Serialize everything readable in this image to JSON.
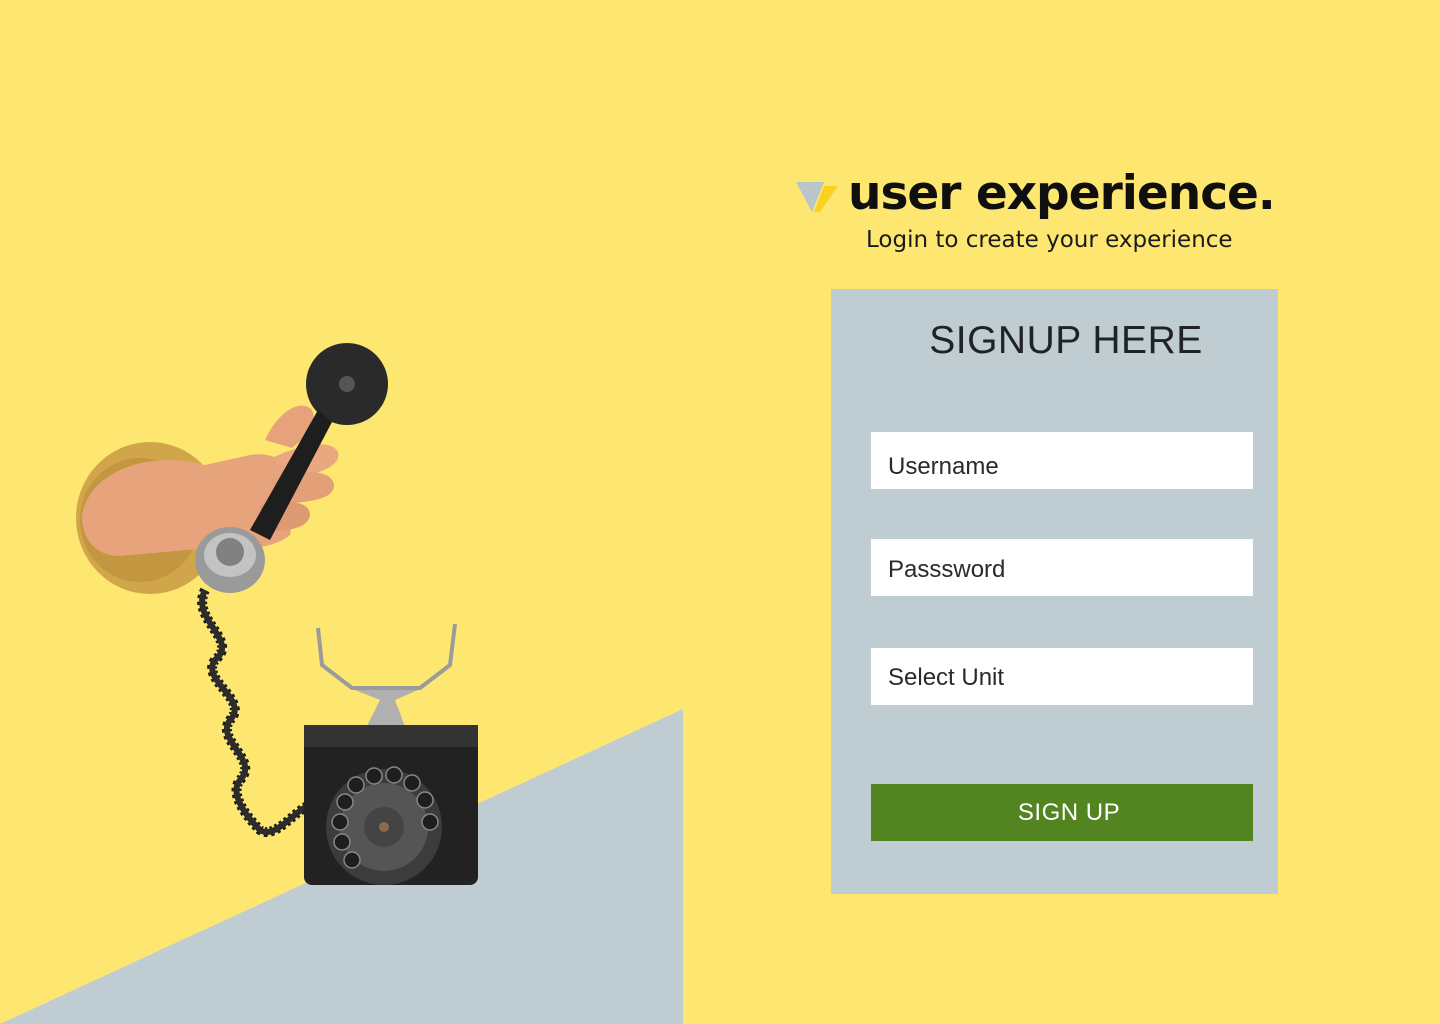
{
  "brand": {
    "title": "user experience.",
    "subtitle": "Login to create your experience",
    "logo_icon": "chevron-v-logo-icon"
  },
  "form": {
    "title": "SIGNUP HERE",
    "username_placeholder": "Username",
    "password_placeholder": "Passsword",
    "unit_placeholder": "Select Unit",
    "submit_label": "SIGN UP"
  },
  "colors": {
    "background": "#fde770",
    "accent_grey": "#bfccd2",
    "button": "#528520",
    "text_dark": "#0f0f0f"
  }
}
